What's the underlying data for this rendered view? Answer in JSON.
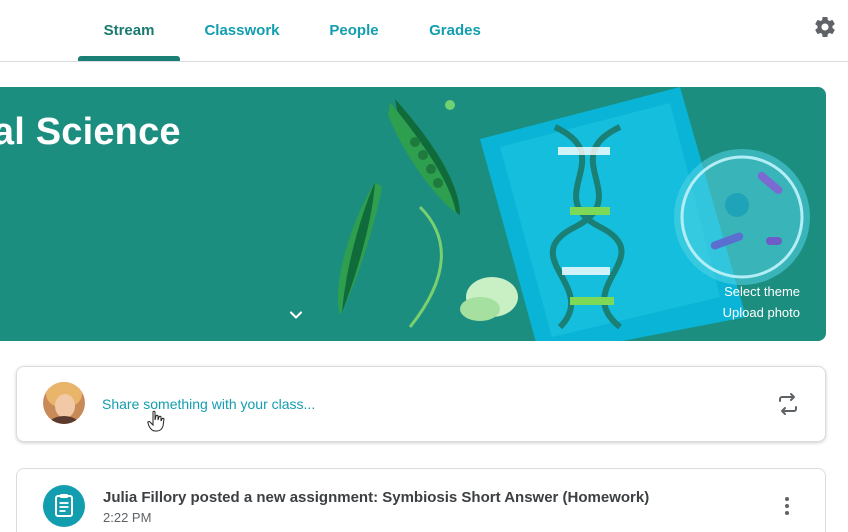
{
  "nav": {
    "tabs": [
      {
        "label": "Stream",
        "active": true
      },
      {
        "label": "Classwork",
        "active": false
      },
      {
        "label": "People",
        "active": false
      },
      {
        "label": "Grades",
        "active": false
      }
    ],
    "settings_icon": "gear-icon"
  },
  "banner": {
    "title": "tal Science",
    "select_theme": "Select theme",
    "upload_photo": "Upload photo",
    "background_color": "#1b8e80",
    "expand_icon": "chevron-down-icon"
  },
  "share": {
    "placeholder": "Share something with your class...",
    "repost_icon": "repost-icon"
  },
  "post": {
    "title": "Julia Fillory posted a new assignment: Symbiosis Short Answer (Homework)",
    "time": "2:22 PM",
    "icon": "assignment-icon",
    "menu_icon": "more-vert-icon"
  },
  "colors": {
    "accent": "#129eaf",
    "active_tab": "#1a7a70",
    "banner": "#1b8e80"
  }
}
